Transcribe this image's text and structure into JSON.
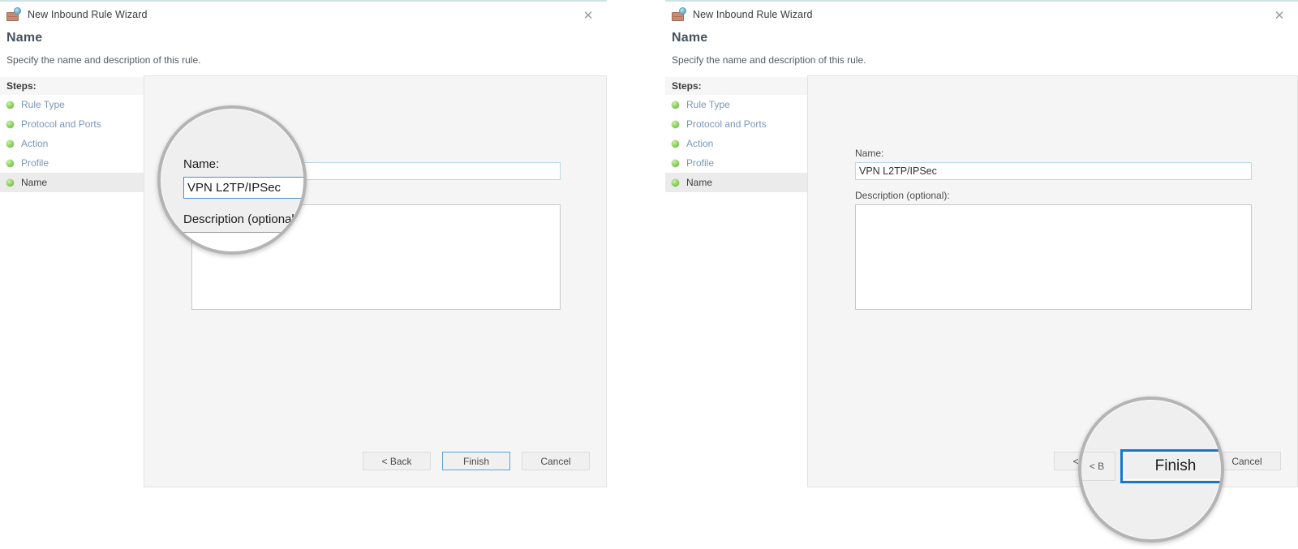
{
  "window": {
    "title": "New Inbound Rule Wizard",
    "icon": "firewall-rule-icon",
    "close_label": "✕"
  },
  "page": {
    "heading": "Name",
    "subheading": "Specify the name and description of this rule."
  },
  "steps": {
    "header": "Steps:",
    "items": [
      {
        "label": "Rule Type",
        "current": false
      },
      {
        "label": "Protocol and Ports",
        "current": false
      },
      {
        "label": "Action",
        "current": false
      },
      {
        "label": "Profile",
        "current": false
      },
      {
        "label": "Name",
        "current": true
      }
    ]
  },
  "form": {
    "name_label": "Name:",
    "name_value": "VPN L2TP/IPSec",
    "description_label": "Description (optional):",
    "description_value": "",
    "description_placeholder": ""
  },
  "footer": {
    "back": "< Back",
    "finish": "Finish",
    "cancel": "Cancel",
    "default_button": "Finish"
  },
  "magnifier_left": {
    "name_label": "Name:",
    "name_value": "VPN L2TP/IPSec",
    "description_label": "Description (optional):"
  },
  "magnifier_right": {
    "back_partial": "< B",
    "finish": "Finish"
  },
  "colors": {
    "accent_blue": "#1577d0",
    "input_border": "#bcd7e2",
    "step_link": "#7a96b8",
    "step_dot_green": "#8ed35f",
    "panel_bg": "#f5f5f5",
    "lens_ring": "#b4b4b4"
  }
}
